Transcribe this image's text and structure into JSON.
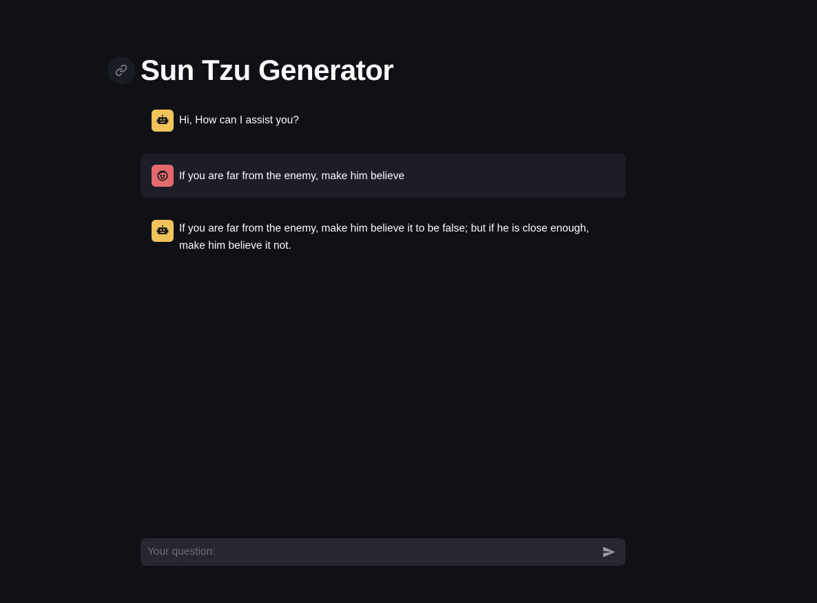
{
  "page": {
    "title": "Sun Tzu Generator"
  },
  "chat": {
    "messages": [
      {
        "role": "assistant",
        "avatar": "robot-icon",
        "text": "Hi, How can I assist you?"
      },
      {
        "role": "user",
        "avatar": "face-icon",
        "text": "If you are far from the enemy, make him believe"
      },
      {
        "role": "assistant",
        "avatar": "robot-icon",
        "text": "If you are far from the enemy, make him believe it to be false; but if he is close enough, make him believe it not."
      }
    ]
  },
  "input": {
    "placeholder": "Your question:",
    "value": ""
  },
  "colors": {
    "background": "#0f1117",
    "assistant_avatar": "#f0c25c",
    "user_avatar": "#e2696d",
    "user_bubble": "#1c1d26",
    "input_bg": "#262730"
  }
}
